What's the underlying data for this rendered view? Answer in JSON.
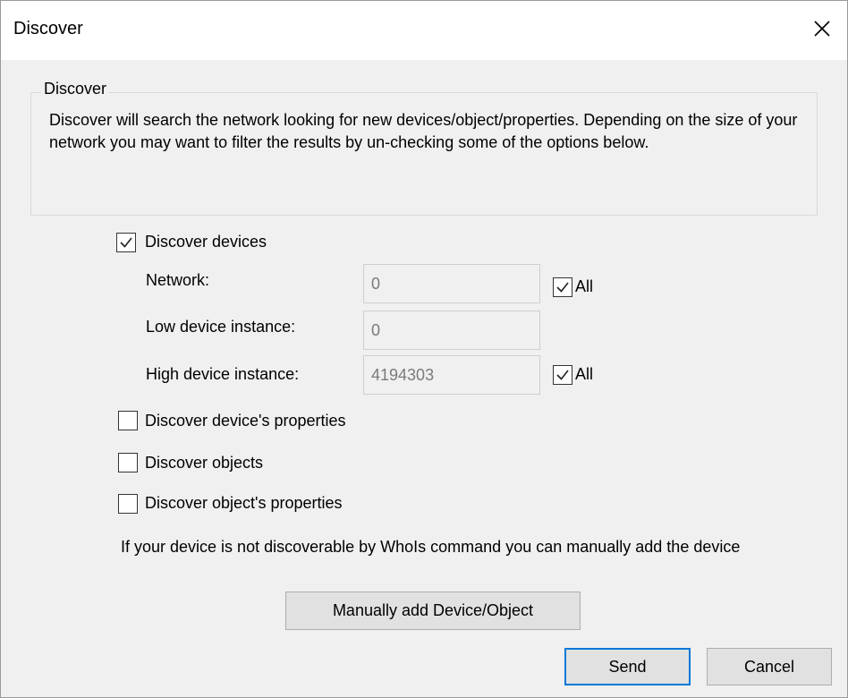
{
  "window": {
    "title": "Discover",
    "close_icon": "close-icon"
  },
  "group": {
    "legend": "Discover",
    "description": "Discover will search the network looking for new devices/object/properties. Depending on the size of your network you may want to filter the results by un-checking some of the options below."
  },
  "options": {
    "discover_devices": {
      "label": "Discover devices",
      "checked": true
    },
    "network": {
      "label": "Network:",
      "value": "0",
      "all_label": "All",
      "all_checked": true
    },
    "low_instance": {
      "label": "Low device instance:",
      "value": "0"
    },
    "high_instance": {
      "label": "High device instance:",
      "value": "4194303",
      "all_label": "All",
      "all_checked": true
    },
    "device_properties": {
      "label": "Discover device's properties",
      "checked": false
    },
    "objects": {
      "label": "Discover objects",
      "checked": false
    },
    "object_properties": {
      "label": "Discover object's properties",
      "checked": false
    }
  },
  "note": "If your device is not discoverable by WhoIs command you can manually add the device",
  "buttons": {
    "manual_add": "Manually add Device/Object",
    "send": "Send",
    "cancel": "Cancel"
  },
  "colors": {
    "accent": "#0078d7",
    "dialog_bg": "#f0f0f0"
  }
}
